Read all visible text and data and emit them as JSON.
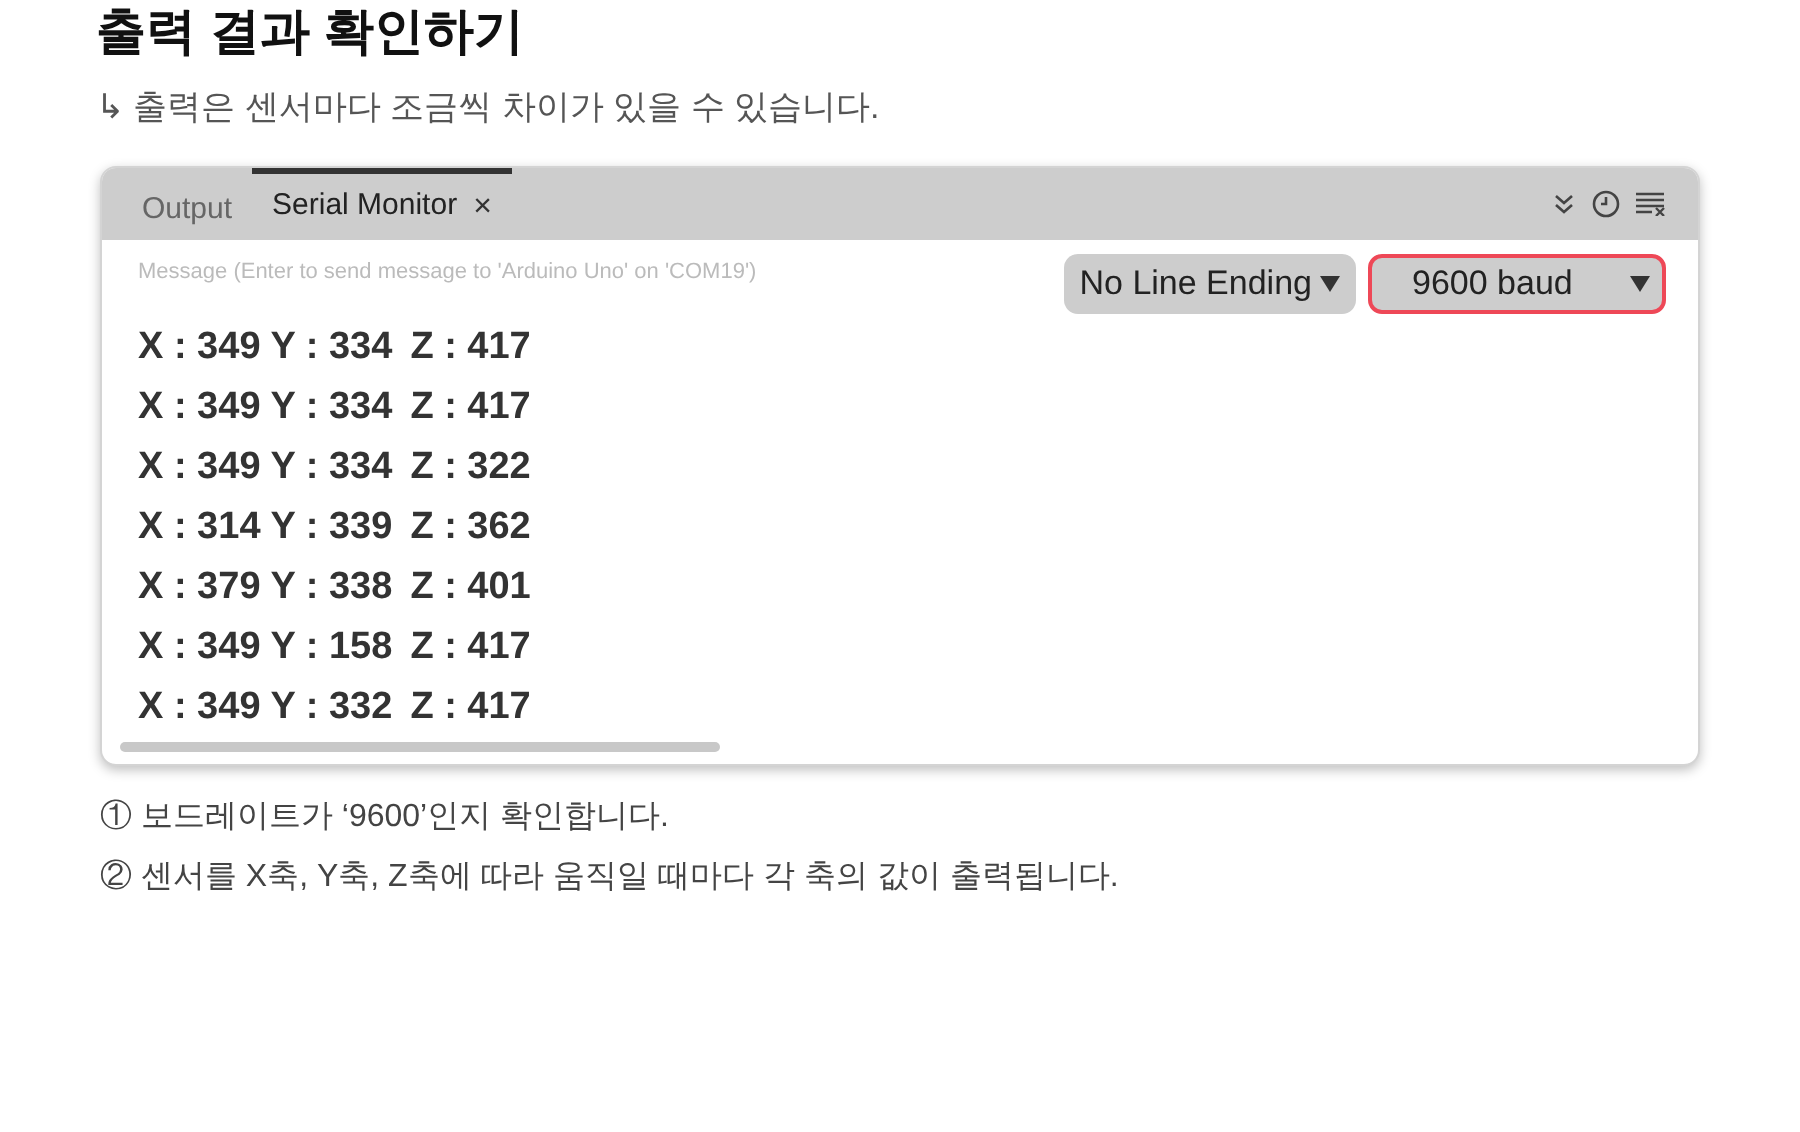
{
  "title": "출력 결과 확인하기",
  "subtitle": "↳ 출력은 센서마다 조금씩 차이가 있을 수 있습니다.",
  "monitor": {
    "tabs": [
      {
        "label": "Output",
        "selected": false
      },
      {
        "label": "Serial Monitor",
        "selected": true,
        "close": "×"
      }
    ],
    "message_field": {
      "placeholder": "Message (Enter to send message to 'Arduino Uno' on 'COM19')"
    },
    "dropdowns": [
      {
        "value": "No Line Ending",
        "highlighted": false
      },
      {
        "value": "9600 baud",
        "highlighted": true
      }
    ],
    "lines": [
      {
        "x": "X : 349",
        "y": "Y : 334",
        "z": "Z : 417"
      },
      {
        "x": "X : 349",
        "y": "Y : 334",
        "z": "Z : 417"
      },
      {
        "x": "X : 349",
        "y": "Y : 334",
        "z": "Z : 322"
      },
      {
        "x": "X : 314",
        "y": "Y : 339",
        "z": "Z : 362"
      },
      {
        "x": "X : 379",
        "y": "Y : 338",
        "z": "Z : 401"
      },
      {
        "x": "X : 349",
        "y": "Y : 158",
        "z": "Z : 417"
      },
      {
        "x": "X : 349",
        "y": "Y : 332",
        "z": "Z : 417"
      }
    ]
  },
  "notes": [
    "① 보드레이트가 ‘9600’인지 확인합니다.",
    "② 센서를 X축, Y축, Z축에 따라 움직일 때마다 각 축의 값이 출력됩니다."
  ]
}
